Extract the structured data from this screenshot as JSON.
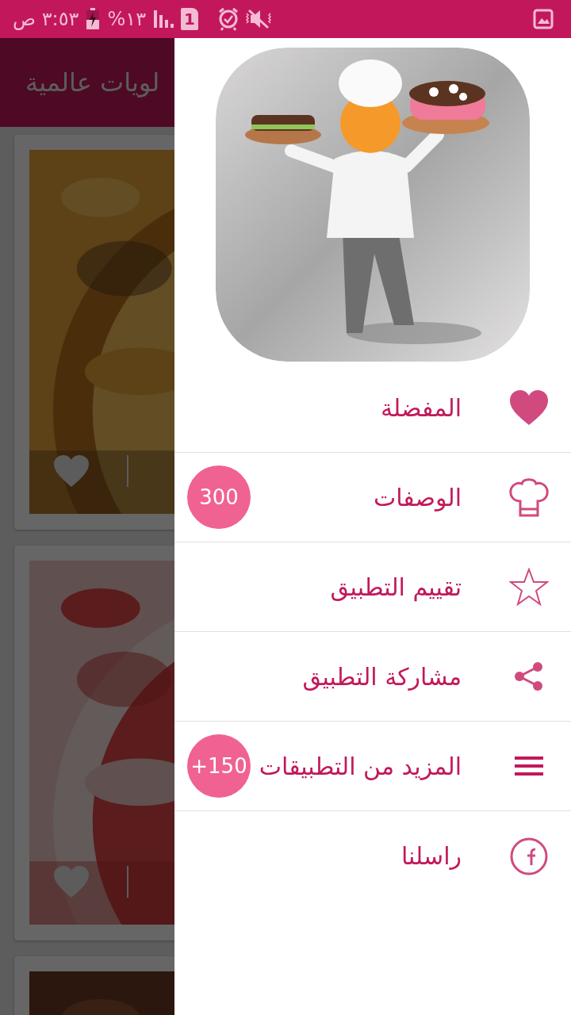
{
  "status_bar": {
    "time": "٣:٥٣ ص",
    "battery": "%١٣",
    "sim": "1"
  },
  "app_bar": {
    "title": "لويات عالمية"
  },
  "drawer": {
    "items": [
      {
        "label": "المفضلة"
      },
      {
        "label": "الوصفات",
        "badge": "300"
      },
      {
        "label": "تقييم التطبيق"
      },
      {
        "label": "مشاركة التطبيق"
      },
      {
        "label": "المزيد من التطبيقات",
        "badge": "+150"
      },
      {
        "label": "راسلنا"
      }
    ]
  }
}
